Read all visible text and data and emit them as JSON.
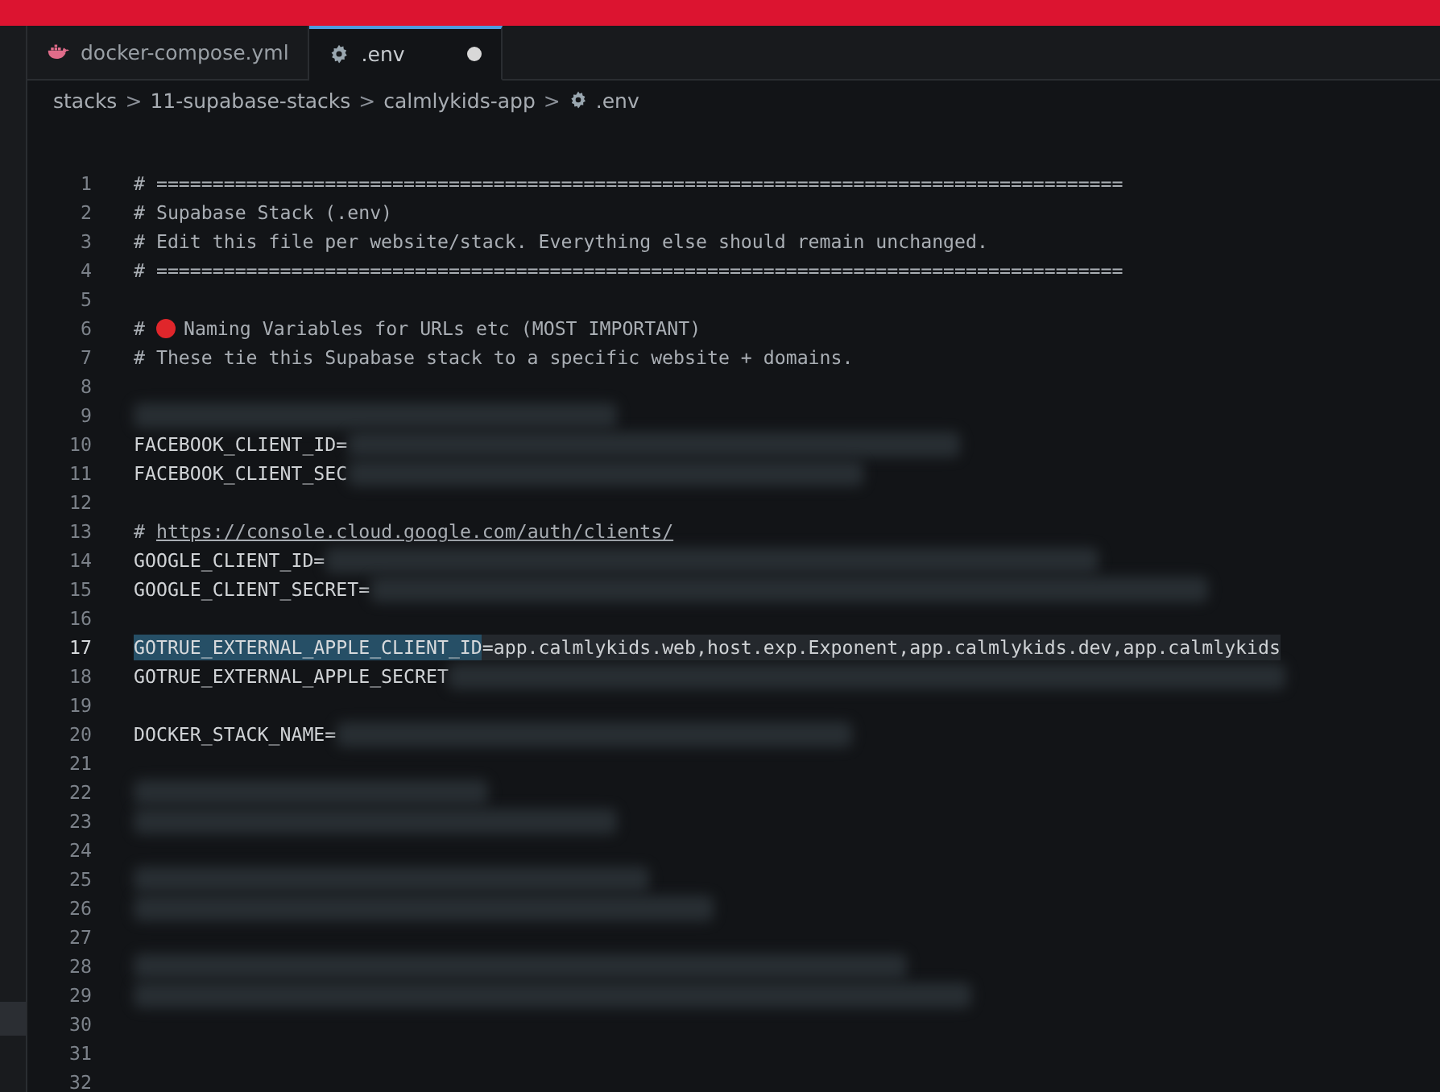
{
  "tabs": [
    {
      "label": "docker-compose.yml",
      "selected": false,
      "modified": false
    },
    {
      "label": ".env",
      "selected": true,
      "modified": true
    }
  ],
  "breadcrumbs": [
    {
      "label": "stacks"
    },
    {
      "label": "11-supabase-stacks"
    },
    {
      "label": "calmlykids-app"
    },
    {
      "label": ".env"
    }
  ],
  "separator": ">",
  "lines": [
    {
      "number": "1",
      "kind": "comment",
      "text": "# ======================================================================================",
      "redacted": false,
      "current": false
    },
    {
      "number": "2",
      "kind": "comment",
      "text": "# Supabase Stack (.env)",
      "redacted": false,
      "current": false
    },
    {
      "number": "3",
      "kind": "comment",
      "text": "# Edit this file per website/stack. Everything else should remain unchanged.",
      "redacted": false,
      "current": false
    },
    {
      "number": "4",
      "kind": "comment",
      "text": "# ======================================================================================",
      "redacted": false,
      "current": false
    },
    {
      "number": "5",
      "kind": "blank",
      "redacted": false,
      "current": false
    },
    {
      "number": "6",
      "kind": "flagged",
      "prefix": "#",
      "text": "Naming Variables for URLs etc (MOST IMPORTANT)",
      "redacted": false,
      "current": false
    },
    {
      "number": "7",
      "kind": "comment",
      "text": "# These tie this Supabase stack to a specific website + domains.",
      "redacted": false,
      "current": false
    },
    {
      "number": "8",
      "kind": "blank",
      "redacted": false,
      "current": false
    },
    {
      "number": "9",
      "kind": "blank",
      "redacted": true,
      "current": false
    },
    {
      "number": "10",
      "kind": "code",
      "text": "FACEBOOK_CLIENT_ID=",
      "redacted": true,
      "current": false
    },
    {
      "number": "11",
      "kind": "code",
      "text": "FACEBOOK_CLIENT_SEC",
      "redacted": true,
      "current": false
    },
    {
      "number": "12",
      "kind": "blank",
      "redacted": false,
      "current": false
    },
    {
      "number": "13",
      "kind": "link",
      "prefix": "#",
      "text": "https://console.cloud.google.com/auth/clients/",
      "redacted": false,
      "current": false
    },
    {
      "number": "14",
      "kind": "code",
      "text": "GOOGLE_CLIENT_ID=",
      "redacted": true,
      "current": false
    },
    {
      "number": "15",
      "kind": "code",
      "text": "GOOGLE_CLIENT_SECRET=",
      "redacted": true,
      "current": false
    },
    {
      "number": "16",
      "kind": "blank",
      "redacted": false,
      "current": false
    },
    {
      "number": "17",
      "kind": "code",
      "highlighted": "GOTRUE_EXTERNAL_APPLE_CLIENT_ID",
      "text": "=app.calmlykids.web,host.exp.Exponent,app.calmlykids.dev,app.calmlykids",
      "redacted": false,
      "current": true
    },
    {
      "number": "18",
      "kind": "code",
      "text": "GOTRUE_EXTERNAL_APPLE_SECRET",
      "redacted": true,
      "current": false
    },
    {
      "number": "19",
      "kind": "blank",
      "redacted": false,
      "current": false
    },
    {
      "number": "20",
      "kind": "code",
      "text": "DOCKER_STACK_NAME=",
      "redacted": true,
      "current": false
    },
    {
      "number": "21",
      "kind": "blank",
      "redacted": false,
      "current": false
    },
    {
      "number": "22",
      "kind": "blank",
      "redacted": true,
      "current": false
    },
    {
      "number": "23",
      "kind": "blank",
      "redacted": true,
      "current": false
    },
    {
      "number": "24",
      "kind": "blank",
      "redacted": false,
      "current": false
    },
    {
      "number": "25",
      "kind": "blank",
      "redacted": true,
      "current": false
    },
    {
      "number": "26",
      "kind": "blank",
      "redacted": true,
      "current": false
    },
    {
      "number": "27",
      "kind": "blank",
      "redacted": false,
      "current": false
    },
    {
      "number": "28",
      "kind": "blank",
      "redacted": true,
      "current": false
    },
    {
      "number": "29",
      "kind": "blank",
      "redacted": true,
      "current": false
    },
    {
      "number": "30",
      "kind": "blank",
      "redacted": false,
      "current": false
    },
    {
      "number": "31",
      "kind": "blank",
      "redacted": false,
      "current": false
    },
    {
      "number": "32",
      "kind": "blank",
      "redacted": false,
      "current": false
    }
  ]
}
